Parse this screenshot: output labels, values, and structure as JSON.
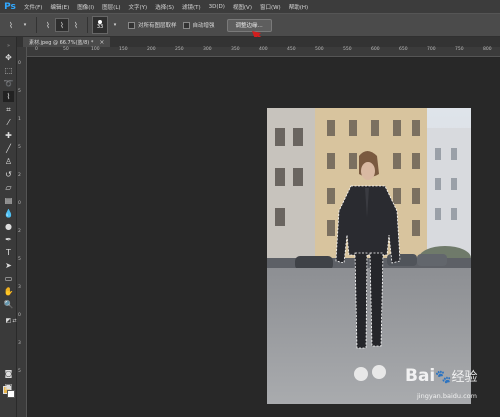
{
  "app": {
    "logo": "Ps"
  },
  "menu": [
    "文件(F)",
    "编辑(E)",
    "图像(I)",
    "图层(L)",
    "文字(Y)",
    "选择(S)",
    "滤镜(T)",
    "3D(D)",
    "视图(V)",
    "窗口(W)",
    "帮助(H)"
  ],
  "options": {
    "brush_size": "33",
    "check_sample_all": "对所有图层取样",
    "check_auto_enhance": "自动增强",
    "refine_edge": "调整边缘..."
  },
  "document": {
    "tab_title": "素材.jpeg @ 66.7%(蓝/8) *",
    "close": "×"
  },
  "ruler_h": [
    "0",
    "50",
    "100",
    "150",
    "200",
    "250",
    "300",
    "350",
    "400",
    "450",
    "500",
    "550",
    "600",
    "650",
    "700",
    "750",
    "800"
  ],
  "ruler_v": [
    "0",
    "5",
    "1",
    "5",
    "2",
    "0",
    "2",
    "5",
    "3",
    "0",
    "3",
    "5"
  ],
  "watermark": {
    "brand": "Bai",
    "cn": "经验",
    "url": "jingyan.baidu.com"
  },
  "colors": {
    "foreground": "#e9b64a",
    "background": "#ffffff",
    "accent": "#31a8ff",
    "annotation_arrow": "#d21e1e"
  }
}
